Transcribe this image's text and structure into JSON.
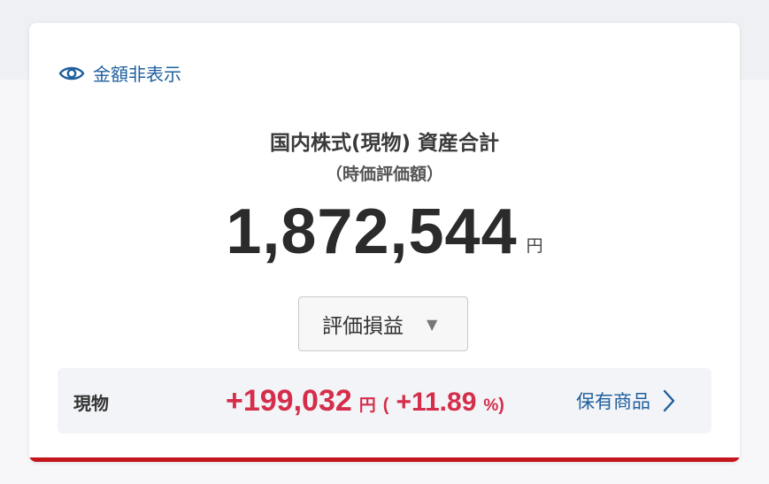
{
  "visibility_toggle": {
    "icon": "eye-icon",
    "label": "金額非表示"
  },
  "summary": {
    "title": "国内株式(現物) 資産合計",
    "subtitle": "（時価評価額）",
    "total_amount": "1,872,544",
    "total_unit": "円"
  },
  "selector": {
    "selected": "評価損益",
    "icon": "caret-down-icon"
  },
  "profit_loss_row": {
    "label": "現物",
    "amount": "+199,032",
    "amount_unit": "円",
    "open_paren": "(",
    "percent": "+11.89",
    "percent_unit": "%",
    "close_paren": ")",
    "link_label": "保有商品",
    "link_icon": "chevron-right-icon"
  },
  "colors": {
    "link": "#1f5f9e",
    "gain": "#d42e4b",
    "accent_bar": "#c4161c"
  }
}
